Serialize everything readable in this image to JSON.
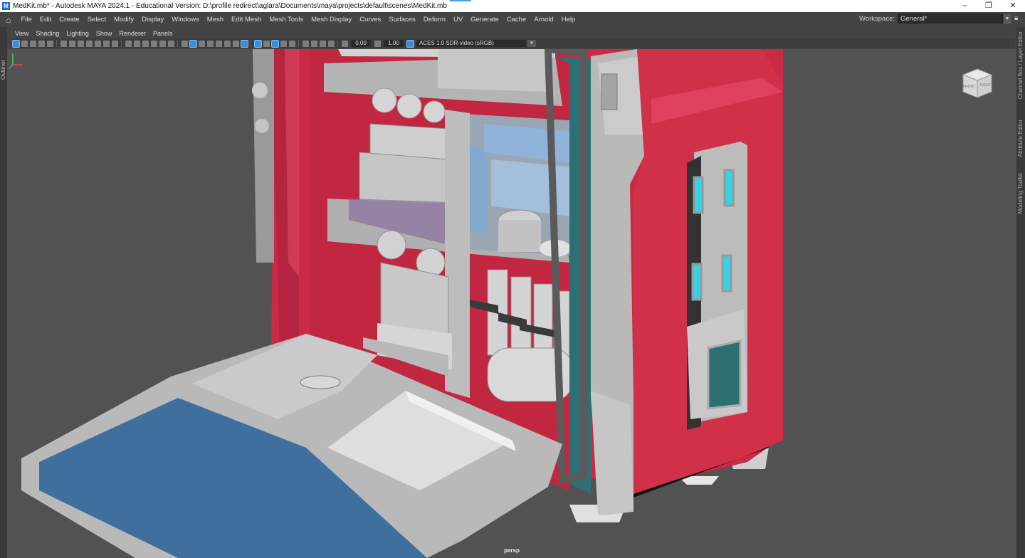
{
  "window": {
    "title": "MedKit.mb* - Autodesk MAYA 2024.1 - Educational Version: D:\\profile redirect\\aglara\\Documents\\maya\\projects\\default\\scenes\\MedKit.mb",
    "app_icon": "M",
    "controls": [
      "–",
      "❐",
      "✕"
    ]
  },
  "main_menu": {
    "items": [
      "File",
      "Edit",
      "Create",
      "Select",
      "Modify",
      "Display",
      "Windows",
      "Mesh",
      "Edit Mesh",
      "Mesh Tools",
      "Mesh Display",
      "Curves",
      "Surfaces",
      "Deform",
      "UV",
      "Generate",
      "Cache",
      "Arnold",
      "Help"
    ],
    "workspace_label": "Workspace:",
    "workspace_value": "General*"
  },
  "left_panel": {
    "tab": "Outliner"
  },
  "right_panel": {
    "tabs": [
      "Channel Box / Layer Editor",
      "Attribute Editor",
      "Modeling Toolkit"
    ]
  },
  "panel_menu": {
    "items": [
      "View",
      "Shading",
      "Lighting",
      "Show",
      "Renderer",
      "Panels"
    ]
  },
  "panel_toolbar": {
    "exposure": "0.00",
    "gamma": "1.00",
    "color_space": "ACES 1.0 SDR-video (sRGB)"
  },
  "viewport": {
    "camera": "persp",
    "viewcube_front": "FRONT",
    "viewcube_right": "RIGHT",
    "colors": {
      "background": "#525252",
      "case_red": "#c92a45",
      "case_red_light": "#d93a55",
      "metal_gray": "#b8b8b8",
      "glass_blue": "#7fa9d4",
      "tray_blue": "#3f6f9d",
      "teal_panel": "#2c7170",
      "cyan_light": "#34d3e6"
    }
  }
}
